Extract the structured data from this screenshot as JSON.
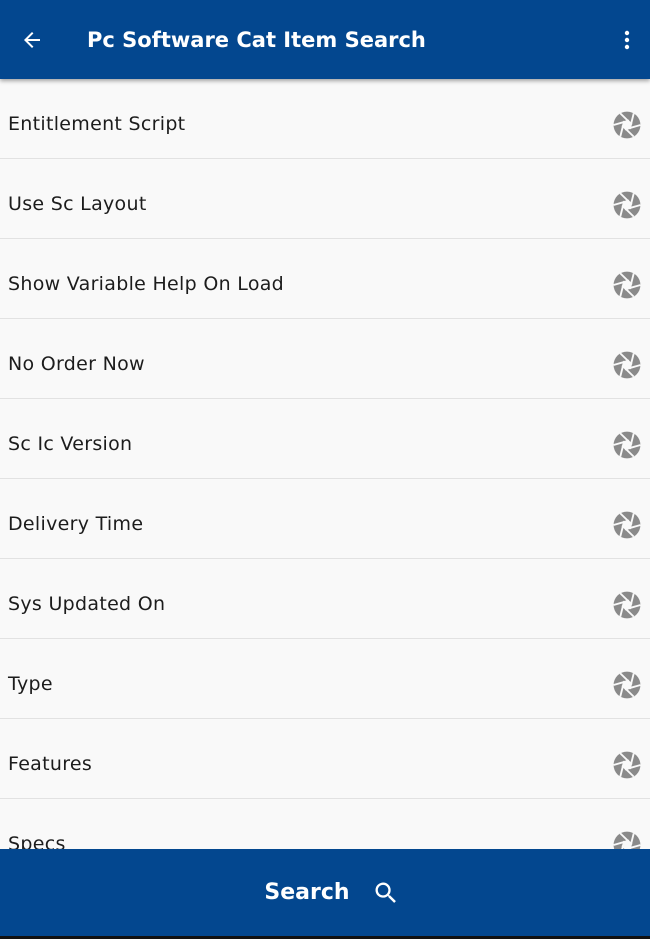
{
  "header": {
    "title": "Pc Software Cat Item Search",
    "back_icon": "arrow-left-icon",
    "menu_icon": "more-vertical-icon"
  },
  "fields": [
    {
      "label": "Entitlement Script",
      "icon": "aperture-icon"
    },
    {
      "label": "Use Sc Layout",
      "icon": "aperture-icon"
    },
    {
      "label": "Show Variable Help On Load",
      "icon": "aperture-icon"
    },
    {
      "label": "No Order Now",
      "icon": "aperture-icon"
    },
    {
      "label": "Sc Ic Version",
      "icon": "aperture-icon"
    },
    {
      "label": "Delivery Time",
      "icon": "aperture-icon"
    },
    {
      "label": "Sys Updated On",
      "icon": "aperture-icon"
    },
    {
      "label": "Type",
      "icon": "aperture-icon"
    },
    {
      "label": "Features",
      "icon": "aperture-icon"
    },
    {
      "label": "Specs",
      "icon": "aperture-icon"
    }
  ],
  "footer": {
    "search_label": "Search",
    "search_icon": "search-icon"
  },
  "colors": {
    "primary": "#03478f",
    "background": "#f9f9f9",
    "divider": "#e2e2e2",
    "icon": "#8a8a8a"
  }
}
